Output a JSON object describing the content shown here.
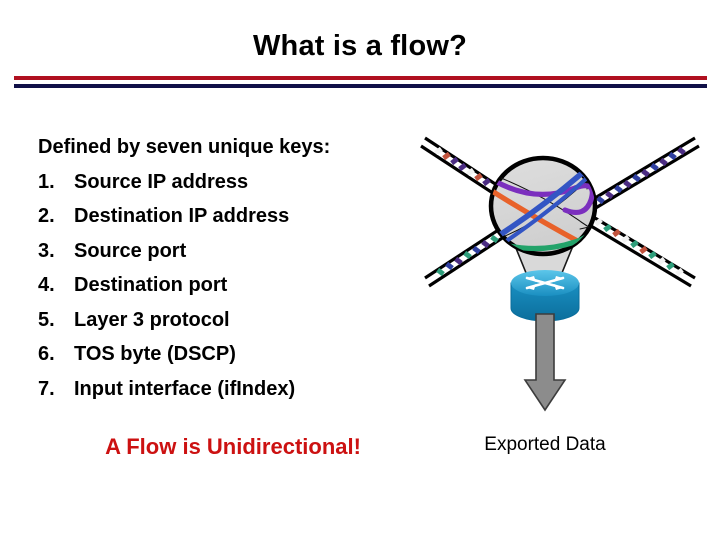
{
  "slide": {
    "title": "What is a flow?",
    "intro": "Defined by seven unique keys:",
    "keys": [
      {
        "number": "1.",
        "label": "Source IP address"
      },
      {
        "number": "2.",
        "label": "Destination IP address"
      },
      {
        "number": "3.",
        "label": "Source port"
      },
      {
        "number": "4.",
        "label": "Destination port"
      },
      {
        "number": "5.",
        "label": "Layer 3 protocol"
      },
      {
        "number": "6.",
        "label": "TOS byte (DSCP)"
      },
      {
        "number": "7.",
        "label": "Input interface (ifIndex)"
      }
    ],
    "emphasis_caption": "A Flow is Unidirectional!",
    "exported_data_caption": "Exported Data"
  },
  "colors": {
    "divider_red": "#b01020",
    "divider_navy": "#101048",
    "emphasis_red": "#cc1111",
    "title_black": "#000000",
    "cloud_fill": "#d4d4d4",
    "router_blue": "#1a8fc1",
    "router_blue_dark": "#0b6e9c",
    "arrow_gray": "#8c8c8c",
    "flow_purple": "#7b2fbe",
    "flow_orange": "#e8622a",
    "flow_blue": "#3355c4",
    "flow_green": "#23a36a",
    "packet_purple": "#4b2c83",
    "packet_blue": "#2f3fa0",
    "packet_green": "#2e9e7b",
    "packet_red": "#c2533d",
    "packet_white": "#f2f2f2"
  },
  "diagram": {
    "name": "netflow-cloud-router-diagram",
    "cloud_label": "network-cloud-sphere",
    "router_label": "cisco-router-icon",
    "export_arrow_label": "exported-data-arrow",
    "packet_trains": [
      {
        "name": "packet-train-upper-left",
        "colors": [
          "#f2f2f2",
          "#c2533d",
          "#4b2c83"
        ]
      },
      {
        "name": "packet-train-upper-right",
        "colors": [
          "#2f3fa0",
          "#4b2c83"
        ]
      },
      {
        "name": "packet-train-lower-left",
        "colors": [
          "#2e9e7b",
          "#2f3fa0",
          "#4b2c83"
        ]
      },
      {
        "name": "packet-train-lower-right",
        "colors": [
          "#2e9e7b",
          "#c2533d",
          "#f2f2f2"
        ]
      }
    ],
    "flows": [
      {
        "name": "flow-curve-purple",
        "color": "#7b2fbe"
      },
      {
        "name": "flow-curve-orange",
        "color": "#e8622a"
      },
      {
        "name": "flow-curve-blue",
        "color": "#3355c4"
      },
      {
        "name": "flow-curve-green",
        "color": "#23a36a"
      }
    ]
  }
}
